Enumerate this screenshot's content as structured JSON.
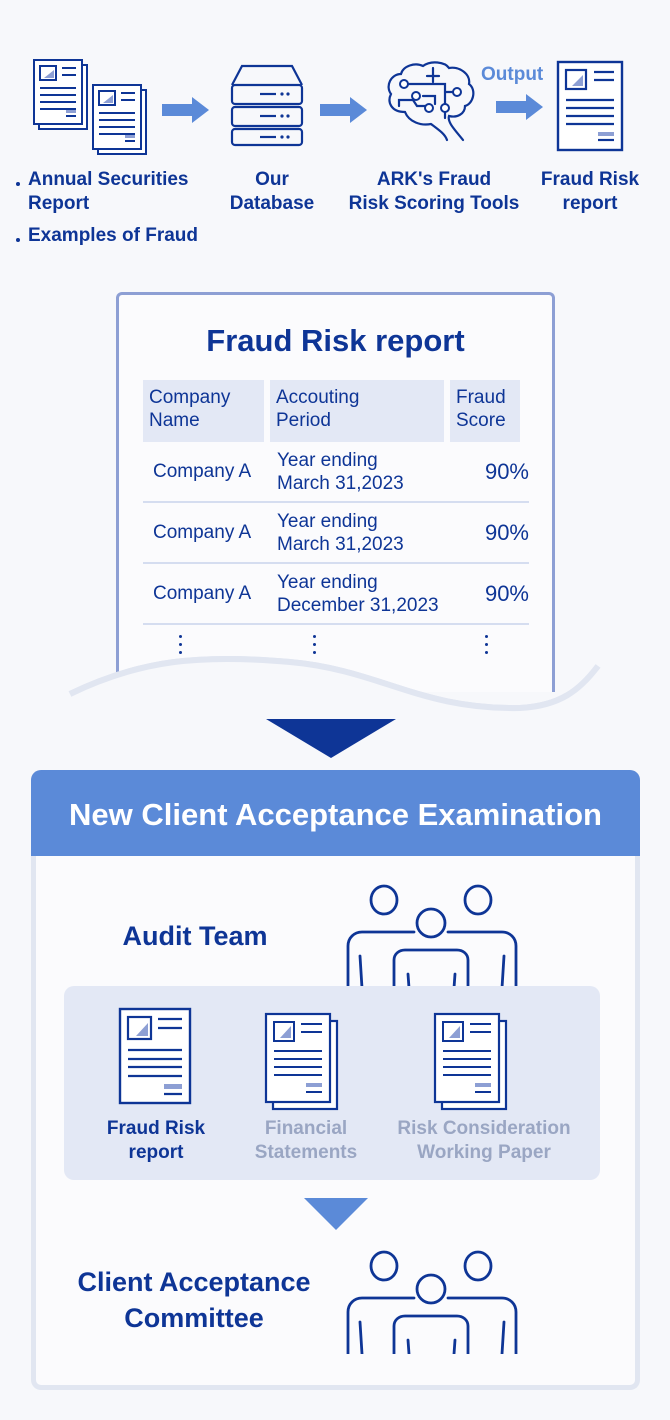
{
  "flow": {
    "sources": {
      "items": [
        "Annual Securities Report",
        "Examples of Fraud"
      ],
      "item_1_line1": "Annual Securities",
      "item_1_line2": "Report",
      "item_2": "Examples of Fraud"
    },
    "database": {
      "line1": "Our",
      "line2": "Database"
    },
    "tool": {
      "line1": "ARK's Fraud",
      "line2": "Risk Scoring Tools"
    },
    "output_label": "Output",
    "report": {
      "line1": "Fraud Risk",
      "line2": "report"
    }
  },
  "report_card": {
    "title": "Fraud Risk report",
    "columns": [
      {
        "line1": "Company",
        "line2": "Name"
      },
      {
        "line1": "Accouting",
        "line2": "Period"
      },
      {
        "line1": "Fraud",
        "line2": "Score"
      }
    ],
    "rows": [
      {
        "company": "Company A",
        "period_line1": "Year ending",
        "period_line2": "March 31,2023",
        "score": "90%"
      },
      {
        "company": "Company A",
        "period_line1": "Year ending",
        "period_line2": "March 31,2023",
        "score": "90%"
      },
      {
        "company": "Company A",
        "period_line1": "Year ending",
        "period_line2": "December 31,2023",
        "score": "90%"
      }
    ],
    "continuation": "⋮"
  },
  "examination": {
    "title": "New Client Acceptance Examination",
    "audit_team": "Audit Team",
    "documents": [
      {
        "line1": "Fraud Risk",
        "line2": "report",
        "state": "active"
      },
      {
        "line1": "Financial",
        "line2": "Statements",
        "state": "muted"
      },
      {
        "line1": "Risk Consideration",
        "line2": "Working Paper",
        "state": "muted"
      }
    ],
    "committee": {
      "line1": "Client Acceptance",
      "line2": "Committee"
    }
  },
  "colors": {
    "primary": "#0e3596",
    "accent": "#5b8ad8",
    "panel": "#e3e8f5",
    "muted_text": "#9aa6c3",
    "border": "#8d9fd4"
  },
  "icons": [
    "document-stack-icon",
    "arrow-right-icon",
    "database-server-icon",
    "ai-brain-icon",
    "document-icon",
    "arrow-down-icon",
    "people-group-icon"
  ]
}
